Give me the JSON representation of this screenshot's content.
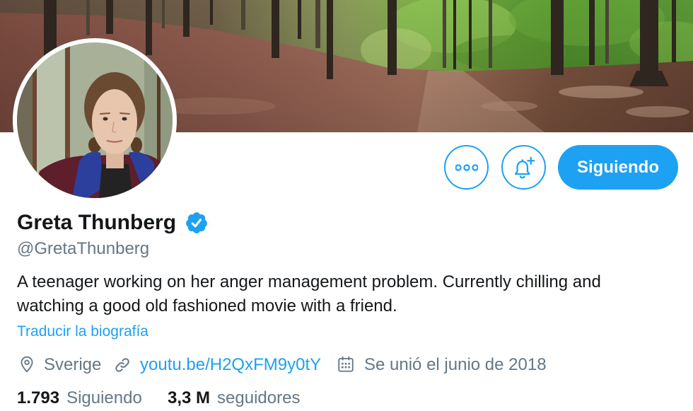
{
  "actions": {
    "more_icon": "more-horizontal-icon",
    "notify_icon": "bell-plus-icon",
    "follow_state_label": "Siguiendo"
  },
  "profile": {
    "name": "Greta Thunberg",
    "verified": true,
    "verified_icon": "verified-badge-icon",
    "handle": "@GretaThunberg",
    "bio": "A teenager working on her anger management problem. Currently chilling and watching a good old fashioned movie with a friend.",
    "translate_bio_label": "Traducir la biografía",
    "location_icon": "location-pin-icon",
    "location": "Sverige",
    "website_icon": "link-icon",
    "website": "youtu.be/H2QxFM9y0tY",
    "joined_icon": "calendar-icon",
    "joined": "Se unió el junio de 2018"
  },
  "stats": {
    "following_count": "1.793",
    "following_label": "Siguiendo",
    "followers_count": "3,3 M",
    "followers_label": "seguidores"
  },
  "colors": {
    "accent": "#1DA1F2",
    "text": "#14171A",
    "secondary": "#657786"
  }
}
